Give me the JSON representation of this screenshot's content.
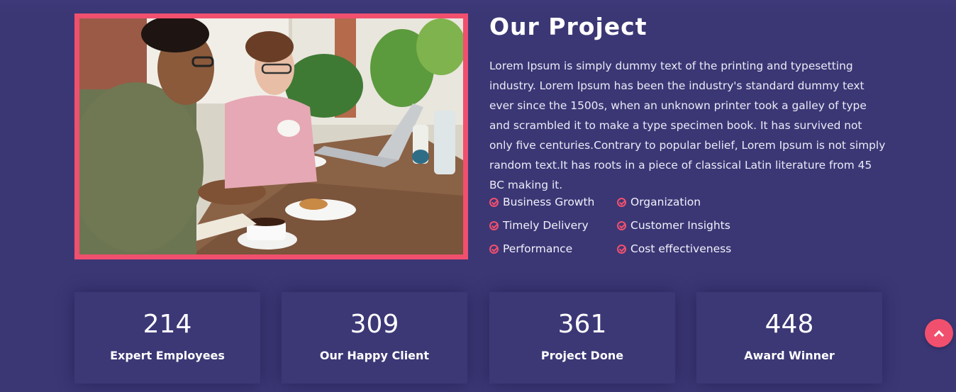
{
  "project": {
    "title": "Our Project",
    "description": "Lorem Ipsum is simply dummy text of the printing and typesetting industry. Lorem Ipsum has been the industry's standard dummy text ever since the 1500s, when an unknown printer took a galley of type and scrambled it to make a type specimen book. It has survived not only five centuries.Contrary to popular belief, Lorem Ipsum is not simply random text.It has roots in a piece of classical Latin literature from 45 BC making it.",
    "features": [
      "Business Growth",
      "Organization",
      "Timely Delivery",
      "Customer Insights",
      "Performance",
      "Cost effectiveness"
    ],
    "feature_icon": "check-circle-icon",
    "accent_color": "#f0506e",
    "background_color": "#3b3775"
  },
  "stats": [
    {
      "value": "214",
      "label": "Expert Employees"
    },
    {
      "value": "309",
      "label": "Our Happy Client"
    },
    {
      "value": "361",
      "label": "Project Done"
    },
    {
      "value": "448",
      "label": "Award Winner"
    }
  ],
  "scroll_top": {
    "icon": "chevron-up-icon"
  }
}
